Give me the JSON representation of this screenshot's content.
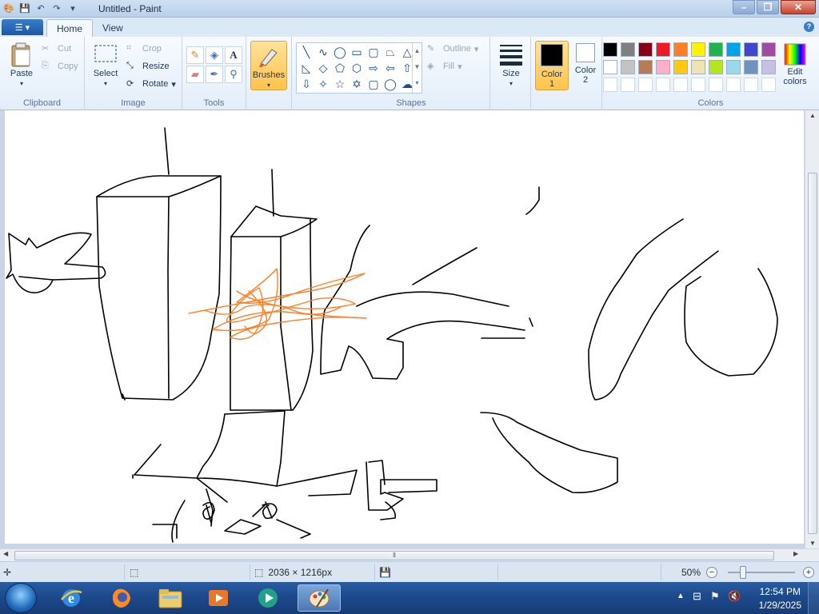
{
  "window": {
    "title": "Untitled - Paint"
  },
  "quick_access": [
    "save-icon",
    "undo-icon",
    "redo-icon",
    "customize-icon"
  ],
  "tabs": [
    {
      "label": "Home"
    },
    {
      "label": "View"
    }
  ],
  "clipboard": {
    "paste": "Paste",
    "cut": "Cut",
    "copy": "Copy",
    "label": "Clipboard"
  },
  "image": {
    "select": "Select",
    "crop": "Crop",
    "resize": "Resize",
    "rotate": "Rotate",
    "label": "Image"
  },
  "tools": {
    "label": "Tools",
    "items": [
      "pencil-icon",
      "fill-icon",
      "text-icon",
      "eraser-icon",
      "color-picker-icon",
      "magnifier-icon"
    ]
  },
  "brushes": {
    "label": "Brushes"
  },
  "shapes": {
    "label": "Shapes",
    "outline": "Outline",
    "fill": "Fill",
    "items": [
      "line-shape",
      "curve-shape",
      "oval-shape",
      "rectangle-shape",
      "rounded-rectangle-shape",
      "polygon-shape",
      "triangle-shape",
      "right-triangle-shape",
      "diamond-shape",
      "pentagon-shape",
      "hexagon-shape",
      "right-arrow-shape",
      "left-arrow-shape",
      "up-arrow-shape",
      "down-arrow-shape",
      "four-point-star-shape",
      "five-point-star-shape",
      "six-point-star-shape",
      "rounded-callout-shape",
      "oval-callout-shape",
      "cloud-callout-shape"
    ]
  },
  "size": {
    "label": "Size"
  },
  "color1": {
    "label_a": "Color",
    "label_b": "1",
    "value": "#000000"
  },
  "color2": {
    "label_a": "Color",
    "label_b": "2",
    "value": "#ffffff"
  },
  "colors": {
    "label": "Colors",
    "edit_a": "Edit",
    "edit_b": "colors",
    "palette": [
      "#000000",
      "#7f7f7f",
      "#880015",
      "#ed1c24",
      "#ff7f27",
      "#fff200",
      "#22b14c",
      "#00a2e8",
      "#3f48cc",
      "#a349a4",
      "#ffffff",
      "#c3c3c3",
      "#b97a57",
      "#ffaec9",
      "#ffc90e",
      "#efe4b0",
      "#b5e61d",
      "#99d9ea",
      "#7092be",
      "#c8bfe7",
      "",
      "",
      "",
      "",
      "",
      "",
      "",
      "",
      "",
      ""
    ]
  },
  "status": {
    "dimensions": "2036 × 1216px",
    "zoom": "50%"
  },
  "taskbar": {
    "apps": [
      "internet-explorer-icon",
      "firefox-icon",
      "file-explorer-icon",
      "media-player-icon",
      "media-center-icon",
      "paint-icon"
    ],
    "time": "12:54 PM",
    "date": "1/29/2025"
  }
}
